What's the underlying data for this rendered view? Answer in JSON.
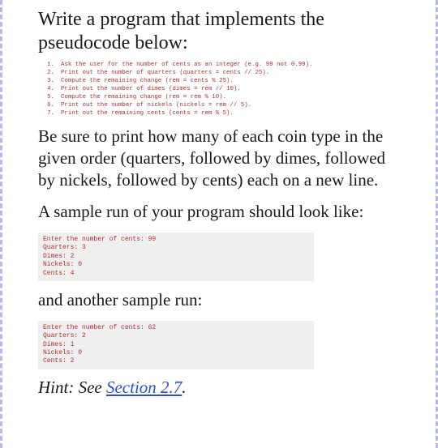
{
  "heading1": "Write a program that implements the pseudocode below:",
  "pseudocode": [
    {
      "n": "1.",
      "t": "Ask the user for the number of cents as an integer (e.g. 99 not 0.99)."
    },
    {
      "n": "2.",
      "t": "Print out the number of quarters (quarters = cents // 25)."
    },
    {
      "n": "3.",
      "t": "Compute the remaining change (rem = cents % 25)."
    },
    {
      "n": "4.",
      "t": "Print out the number of dimes (dimes = rem // 10)."
    },
    {
      "n": "5.",
      "t": "Compute the remaining change (rem = rem % 10)."
    },
    {
      "n": "6.",
      "t": "Print out the number of nickels (nickels = rem // 5)."
    },
    {
      "n": "7.",
      "t": "Print out the remaining cents (cents = rem % 5)."
    }
  ],
  "para1": "Be sure to print how many of each coin type in the given order (quarters, followed by dimes, followed by nickels, followed by cents) each on a new line.",
  "para2": "A sample run of your program should look like:",
  "sample1": "Enter the number of cents: 99\nQuarters: 3\nDimes: 2\nNickels: 0\nCents: 4",
  "para3": "and another sample run:",
  "sample2": "Enter the number of cents: 62\nQuarters: 2\nDimes: 1\nNickels: 0\nCents: 2",
  "hint_prefix": "Hint: See ",
  "hint_link": "Section 2.7",
  "hint_suffix": "."
}
